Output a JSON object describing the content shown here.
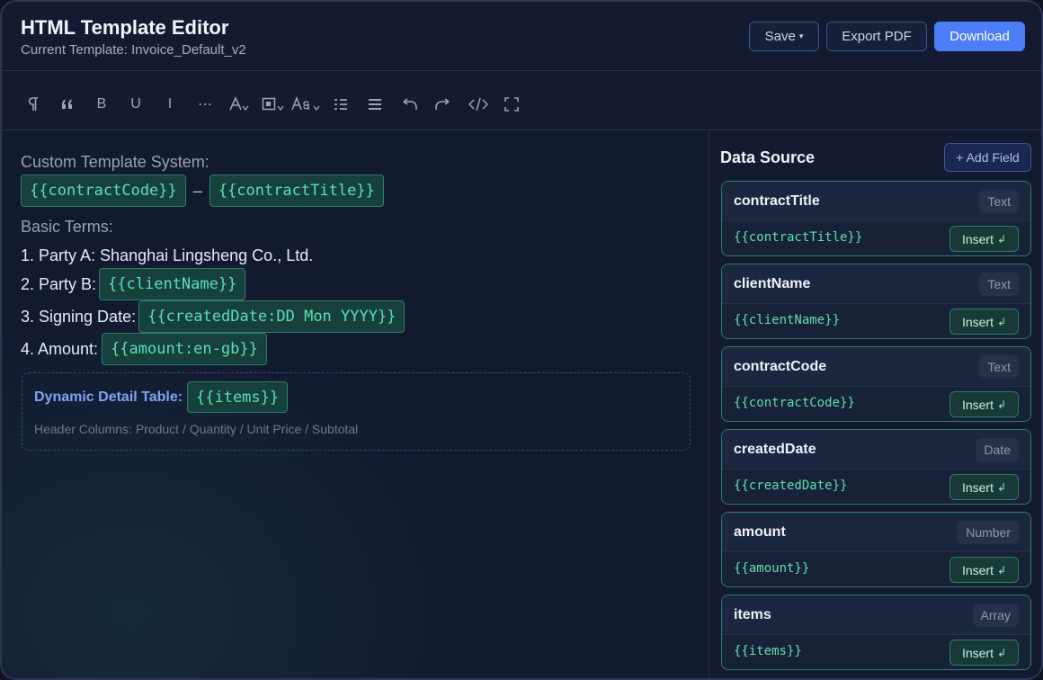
{
  "header": {
    "title": "HTML Template Editor",
    "subtitle": "Current Template: Invoice_Default_v2",
    "save_label": "Save",
    "save_caret": "▾",
    "export_label": "Export PDF",
    "download_label": "Download"
  },
  "toolbar": {
    "tools": [
      "paragraph-icon",
      "quote-icon",
      "bold-icon",
      "underline-icon",
      "italic-icon",
      "more-icon",
      "font-color-icon",
      "highlight-icon",
      "font-size-icon",
      "list-icon",
      "align-icon",
      "undo-icon",
      "redo-icon",
      "code-view-icon",
      "fullscreen-icon"
    ],
    "bold": "B",
    "underline": "U",
    "italic": "I",
    "more": "⋯"
  },
  "editor": {
    "heading": "Custom Template System:",
    "contract_code": "{{contractCode}}",
    "separator": "–",
    "contract_title": "{{contractTitle}}",
    "basic_terms": "Basic Terms:",
    "party_a": "1. Party A: Shanghai Lingsheng Co., Ltd.",
    "party_b_label": "2. Party B:",
    "party_b_token": "{{clientName}}",
    "signing_label": "3. Signing Date:",
    "signing_token": "{{createdDate:DD Mon YYYY}}",
    "amount_label": "4. Amount:",
    "amount_token": "{{amount:en-gb}}",
    "dynamic_label": "Dynamic Detail Table:",
    "dynamic_token": "{{items}}",
    "header_columns": "Header Columns: Product / Quantity / Unit Price / Subtotal"
  },
  "panel": {
    "title": "Data Source",
    "add_field": "+ Add Field",
    "insert_label": "Insert",
    "insert_symbol": "↲",
    "fields": [
      {
        "name": "contractTitle",
        "type": "Text",
        "token": "{{contractTitle}}"
      },
      {
        "name": "clientName",
        "type": "Text",
        "token": "{{clientName}}"
      },
      {
        "name": "contractCode",
        "type": "Text",
        "token": "{{contractCode}}"
      },
      {
        "name": "createdDate",
        "type": "Date",
        "token": "{{createdDate}}"
      },
      {
        "name": "amount",
        "type": "Number",
        "token": "{{amount}}"
      },
      {
        "name": "items",
        "type": "Array",
        "token": "{{items}}"
      }
    ]
  },
  "colors": {
    "accent": "#4d7df6",
    "token": "#5ee0b3",
    "background": "#121a30"
  }
}
